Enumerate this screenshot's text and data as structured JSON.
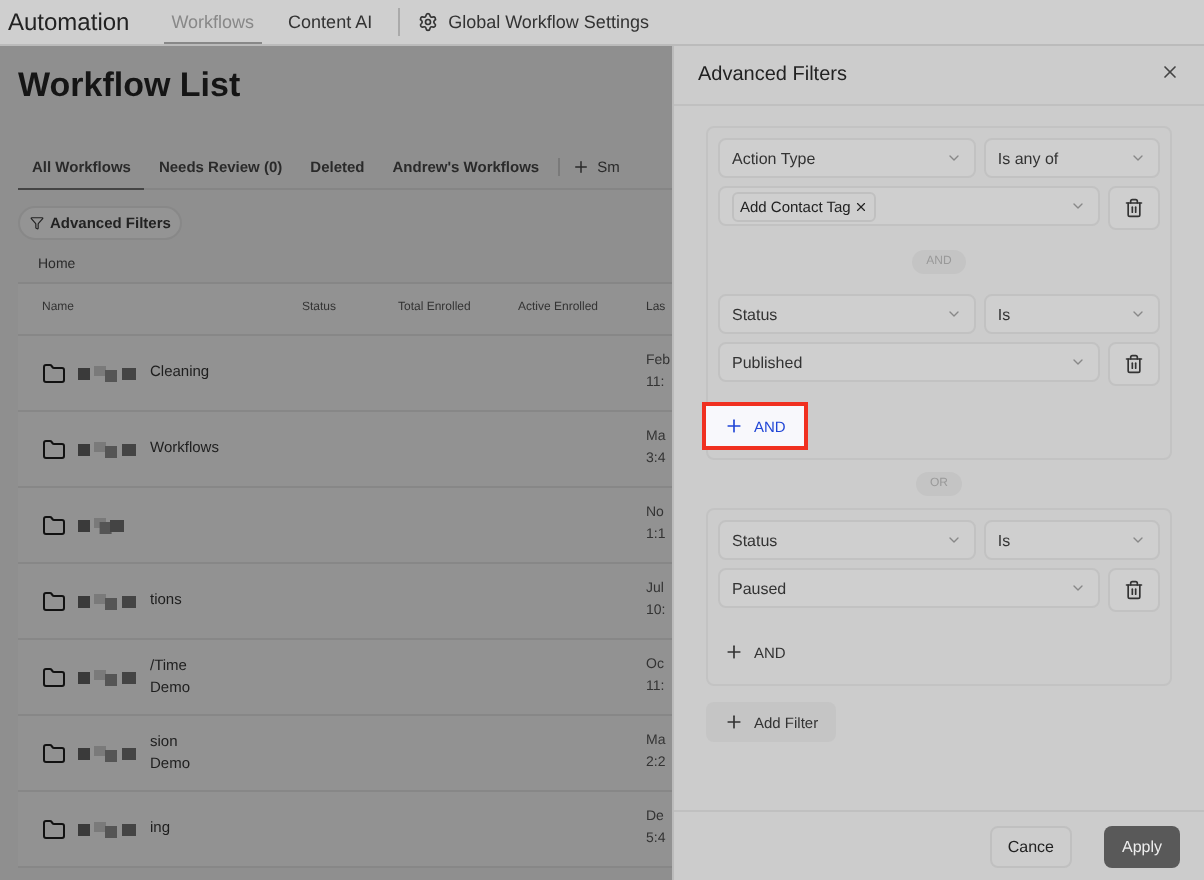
{
  "top_nav": {
    "title": "Automation",
    "tabs": [
      {
        "label": "Workflows",
        "selected": true
      },
      {
        "label": "Content AI",
        "selected": false
      }
    ],
    "settings_link": "Global Workflow Settings"
  },
  "page": {
    "title": "Workflow List",
    "tabs": [
      {
        "label": "All Workflows",
        "selected": true
      },
      {
        "label": "Needs Review (0)",
        "selected": false
      },
      {
        "label": "Deleted",
        "selected": false
      },
      {
        "label": "Andrew's Workflows",
        "selected": false
      }
    ],
    "add_tab": "Sm",
    "filter_button": "Advanced Filters",
    "breadcrumb": "Home"
  },
  "table": {
    "columns": [
      "Name",
      "Status",
      "Total Enrolled",
      "Active Enrolled",
      "Las"
    ],
    "rows": [
      {
        "name": "Cleaning",
        "last": [
          "Feb",
          "11:"
        ]
      },
      {
        "name": "Workflows",
        "last": [
          "Ma",
          "3:4"
        ]
      },
      {
        "last": [
          "No",
          "1:1"
        ]
      },
      {
        "name": "tions",
        "last": [
          "Jul",
          "10:"
        ]
      },
      {
        "name": "/Time",
        "subtitle": "Demo",
        "last": [
          "Oc",
          "11:"
        ]
      },
      {
        "name": "sion",
        "subtitle": "Demo",
        "last": [
          "Ma",
          "2:2"
        ]
      },
      {
        "name": "ing",
        "last": [
          "De",
          "5:4"
        ]
      }
    ]
  },
  "panel": {
    "title": "Advanced Filters",
    "groups": [
      {
        "conditions": [
          {
            "field": "Action Type",
            "operator": "Is any of",
            "value": {
              "kind": "tags",
              "tags": [
                "Add Contact Tag"
              ]
            }
          },
          {
            "field": "Status",
            "operator": "Is",
            "value": {
              "kind": "select",
              "text": "Published"
            }
          }
        ],
        "add_and": {
          "label": "AND",
          "highlighted": true
        }
      },
      {
        "conditions": [
          {
            "field": "Status",
            "operator": "Is",
            "value": {
              "kind": "select",
              "text": "Paused"
            }
          }
        ],
        "add_and": {
          "label": "AND",
          "highlighted": false
        }
      }
    ],
    "condition_joiner": "AND",
    "group_joiner": "OR",
    "add_filter": "Add Filter",
    "buttons": {
      "cancel": "Cance",
      "apply": "Apply"
    }
  }
}
